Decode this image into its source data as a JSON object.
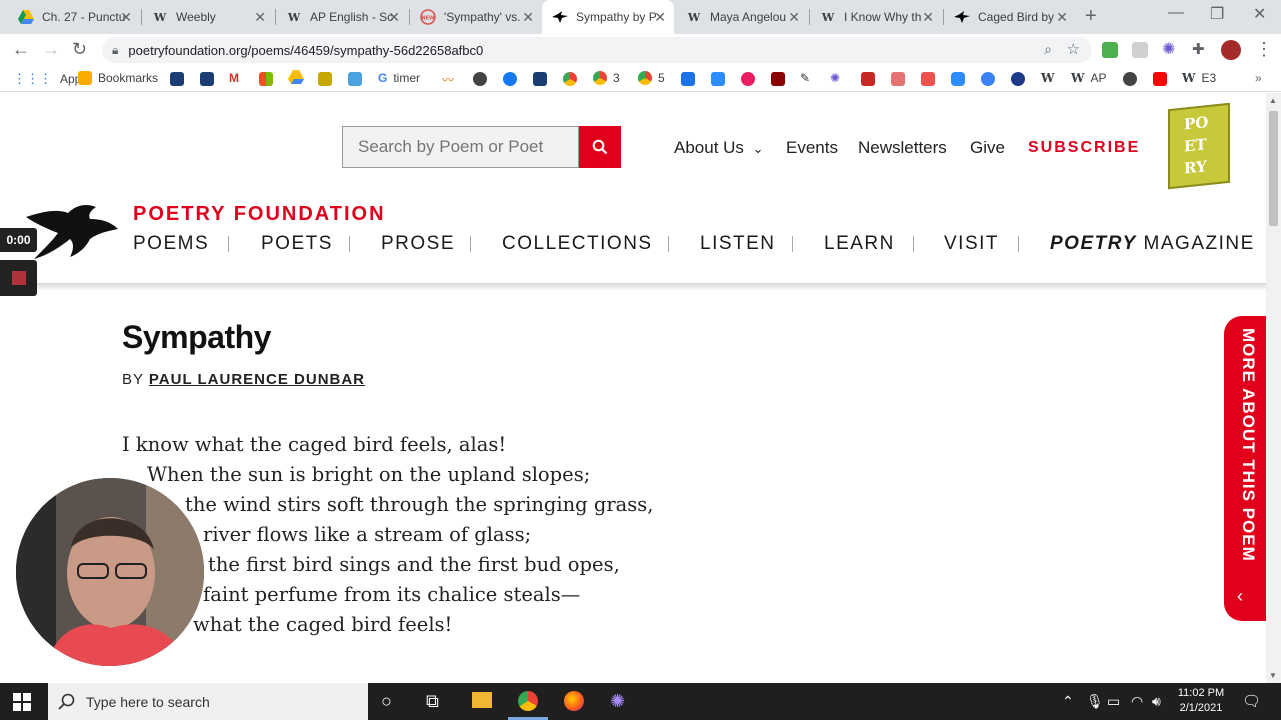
{
  "browser": {
    "tabs": [
      {
        "title": "Ch. 27 - Punctu",
        "icon": "google-drive-icon"
      },
      {
        "title": "Weebly",
        "icon": "weebly-icon"
      },
      {
        "title": "AP English - Sc",
        "icon": "wikispaces-icon"
      },
      {
        "title": "'Sympathy' vs.",
        "icon": "newsela-icon"
      },
      {
        "title": "Sympathy by P",
        "icon": "poetry-foundation-icon"
      },
      {
        "title": "Maya Angelou",
        "icon": "wikipedia-icon"
      },
      {
        "title": "I Know Why th",
        "icon": "wikipedia-icon"
      },
      {
        "title": "Caged Bird by",
        "icon": "poetry-foundation-icon"
      }
    ],
    "url": "poetryfoundation.org/poems/46459/sympathy-56d22658afbc0",
    "bookmarks": {
      "apps": "Apps",
      "bookmarks": "Bookmarks",
      "timer": "timer",
      "num3": "3",
      "num5": "5",
      "ap": "AP",
      "e3": "E3"
    }
  },
  "site": {
    "search_placeholder": "Search by Poem or Poet",
    "top_nav": {
      "about": "About Us",
      "events": "Events",
      "newsletters": "Newsletters",
      "give": "Give",
      "subscribe": "SUBSCRIBE"
    },
    "logo_letters": [
      "PO",
      "ET",
      "RY"
    ],
    "brand": "POETRY FOUNDATION",
    "main_nav": {
      "poems": "POEMS",
      "poets": "POETS",
      "prose": "PROSE",
      "collections": "COLLECTIONS",
      "listen": "LISTEN",
      "learn": "LEARN",
      "visit": "VISIT",
      "magazine_italic": "POETRY",
      "magazine_rest": " MAGAZINE"
    },
    "more_tab": "MORE ABOUT THIS POEM"
  },
  "poem": {
    "title": "Sympathy",
    "by": "BY ",
    "author": "PAUL LAURENCE DUNBAR",
    "lines": [
      "I know what the caged bird feels, alas!",
      "When the sun is bright on the upland slopes;",
      "the wind stirs soft through the springing grass,",
      "river flows like a stream of glass;",
      "the first bird sings and the first bud opes,",
      "faint perfume from its chalice steals—",
      "what the caged bird feels!"
    ]
  },
  "recorder": {
    "time": "0:00"
  },
  "taskbar": {
    "search_placeholder": "Type here to search",
    "time": "11:02 PM",
    "date": "2/1/2021"
  },
  "colors": {
    "brand_red": "#e0001b",
    "logo_yellow": "#c7c93a"
  }
}
